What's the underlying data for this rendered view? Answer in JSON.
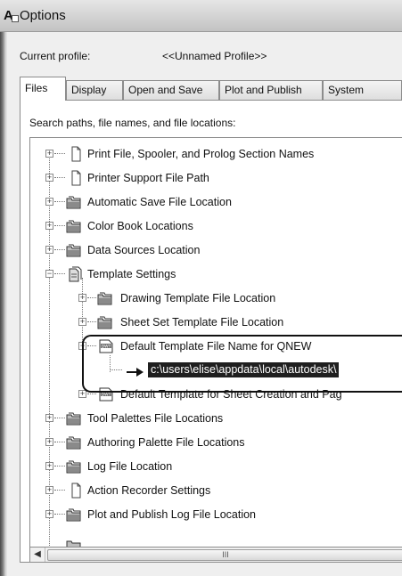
{
  "window": {
    "title": "Options",
    "app_icon_letter": "A"
  },
  "profile": {
    "label": "Current profile:",
    "value": "<<Unnamed Profile>>"
  },
  "tabs": [
    {
      "label": "Files"
    },
    {
      "label": "Display"
    },
    {
      "label": "Open and Save"
    },
    {
      "label": "Plot and Publish"
    },
    {
      "label": "System"
    }
  ],
  "section_label": "Search paths, file names, and file locations:",
  "tree": {
    "items": [
      {
        "label": "Print File, Spooler, and Prolog Section Names",
        "icon": "page-icon"
      },
      {
        "label": "Printer Support File Path",
        "icon": "page-icon"
      },
      {
        "label": "Automatic Save File Location",
        "icon": "folders-icon"
      },
      {
        "label": "Color Book Locations",
        "icon": "folders-icon"
      },
      {
        "label": "Data Sources Location",
        "icon": "folders-icon"
      },
      {
        "label": "Template Settings",
        "icon": "pages-icon"
      },
      {
        "label": "Drawing Template File Location",
        "icon": "folders-icon"
      },
      {
        "label": "Sheet Set Template File Location",
        "icon": "folders-icon"
      },
      {
        "label": "Default Template File Name for QNEW",
        "icon": "dwt-icon"
      },
      {
        "label": "c:\\users\\elise\\appdata\\local\\autodesk\\",
        "icon": "arrow-icon"
      },
      {
        "label": "Default Template for Sheet Creation and Pag",
        "icon": "dwt-icon"
      },
      {
        "label": "Tool Palettes File Locations",
        "icon": "folders-icon"
      },
      {
        "label": "Authoring Palette File Locations",
        "icon": "folders-icon"
      },
      {
        "label": "Log File Location",
        "icon": "folders-icon"
      },
      {
        "label": "Action Recorder Settings",
        "icon": "page-icon"
      },
      {
        "label": "Plot and Publish Log File Location",
        "icon": "folders-icon"
      }
    ]
  },
  "scrollbar": {
    "thumb_grip": "III"
  }
}
